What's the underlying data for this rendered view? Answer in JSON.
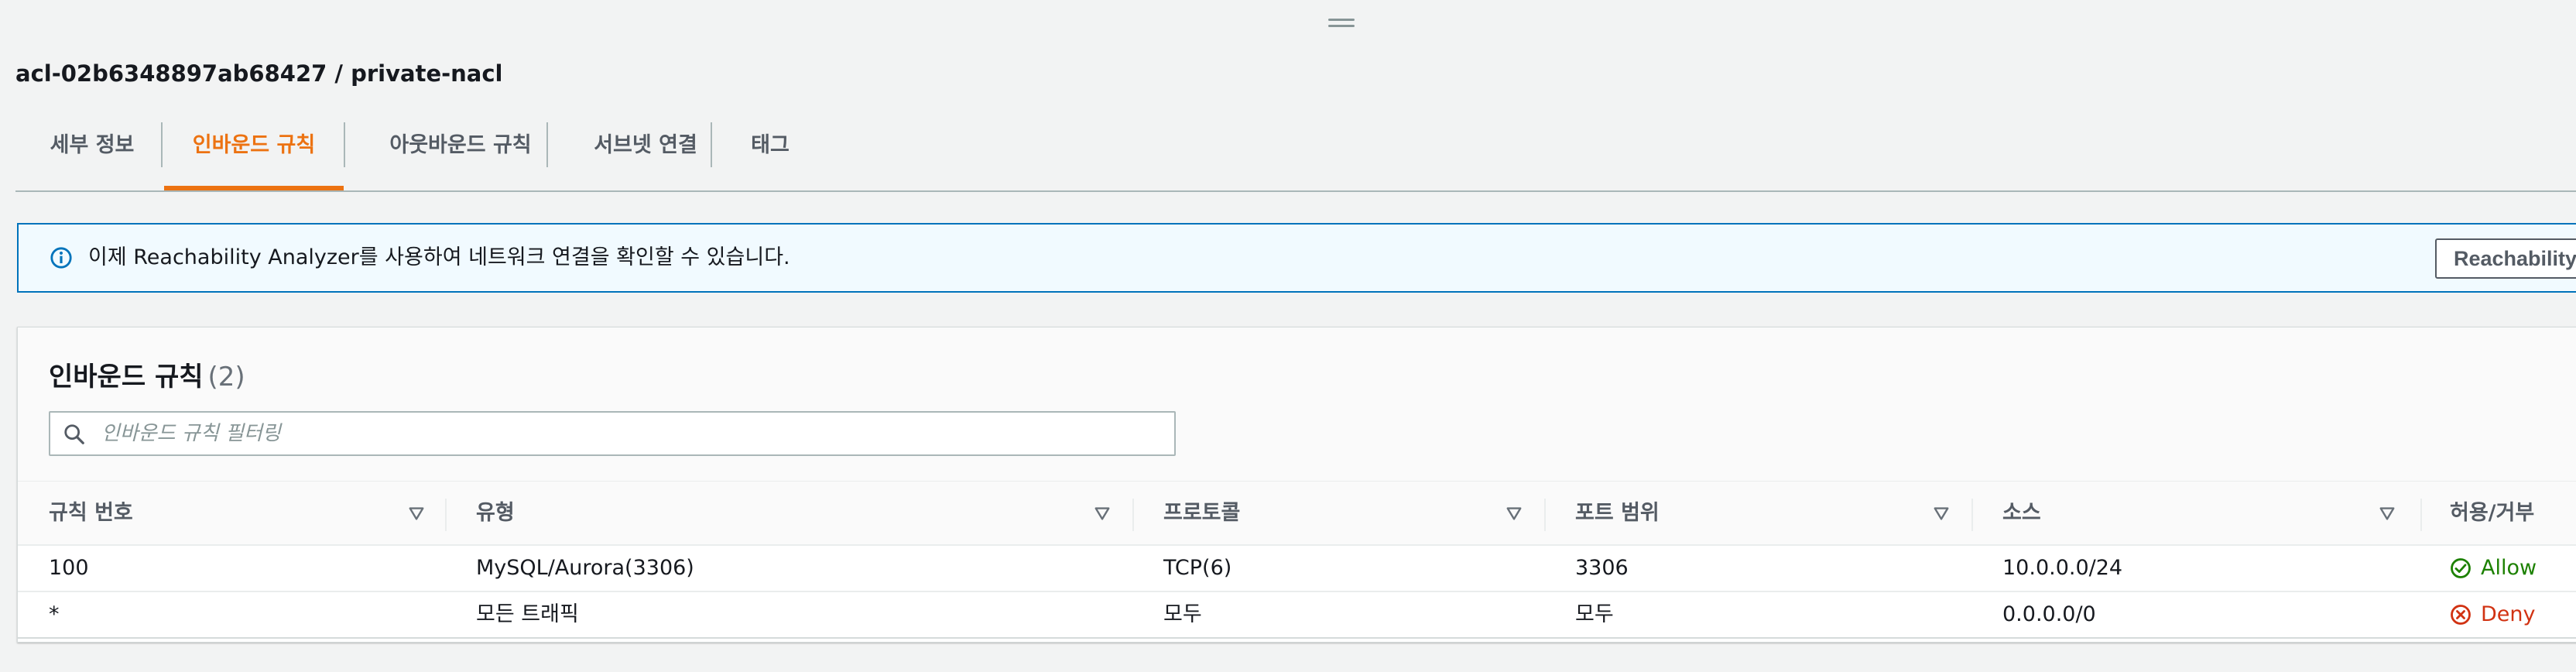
{
  "page": {
    "title": "acl-02b6348897ab68427 / private-nacl"
  },
  "tabs": [
    {
      "label": "세부 정보",
      "active": false
    },
    {
      "label": "인바운드 규칙",
      "active": true
    },
    {
      "label": "아웃바운드 규칙",
      "active": false
    },
    {
      "label": "서브넷 연결",
      "active": false
    },
    {
      "label": "태그",
      "active": false
    }
  ],
  "banner": {
    "icon": "info-icon",
    "text": "이제 Reachability Analyzer를 사용하여 네트워크 연결을 확인할 수 있습니다.",
    "button_label": "Reachability Analyzer"
  },
  "panel": {
    "title": "인바운드 규칙",
    "count": "(2)"
  },
  "filter": {
    "placeholder": "인바운드 규칙 필터링",
    "value": ""
  },
  "table": {
    "columns": [
      "규칙 번호",
      "유형",
      "프로토콜",
      "포트 범위",
      "소스",
      "허용/거부"
    ],
    "rows": [
      {
        "rule_number": "100",
        "type": "MySQL/Aurora(3306)",
        "protocol": "TCP(6)",
        "port_range": "3306",
        "source": "10.0.0.0/24",
        "action": "Allow"
      },
      {
        "rule_number": "*",
        "type": "모든 트래픽",
        "protocol": "모두",
        "port_range": "모두",
        "source": "0.0.0.0/0",
        "action": "Deny"
      }
    ]
  },
  "colors": {
    "accent": "#ec7211",
    "info": "#0073bb",
    "allow": "#1d8102",
    "deny": "#d13212"
  }
}
